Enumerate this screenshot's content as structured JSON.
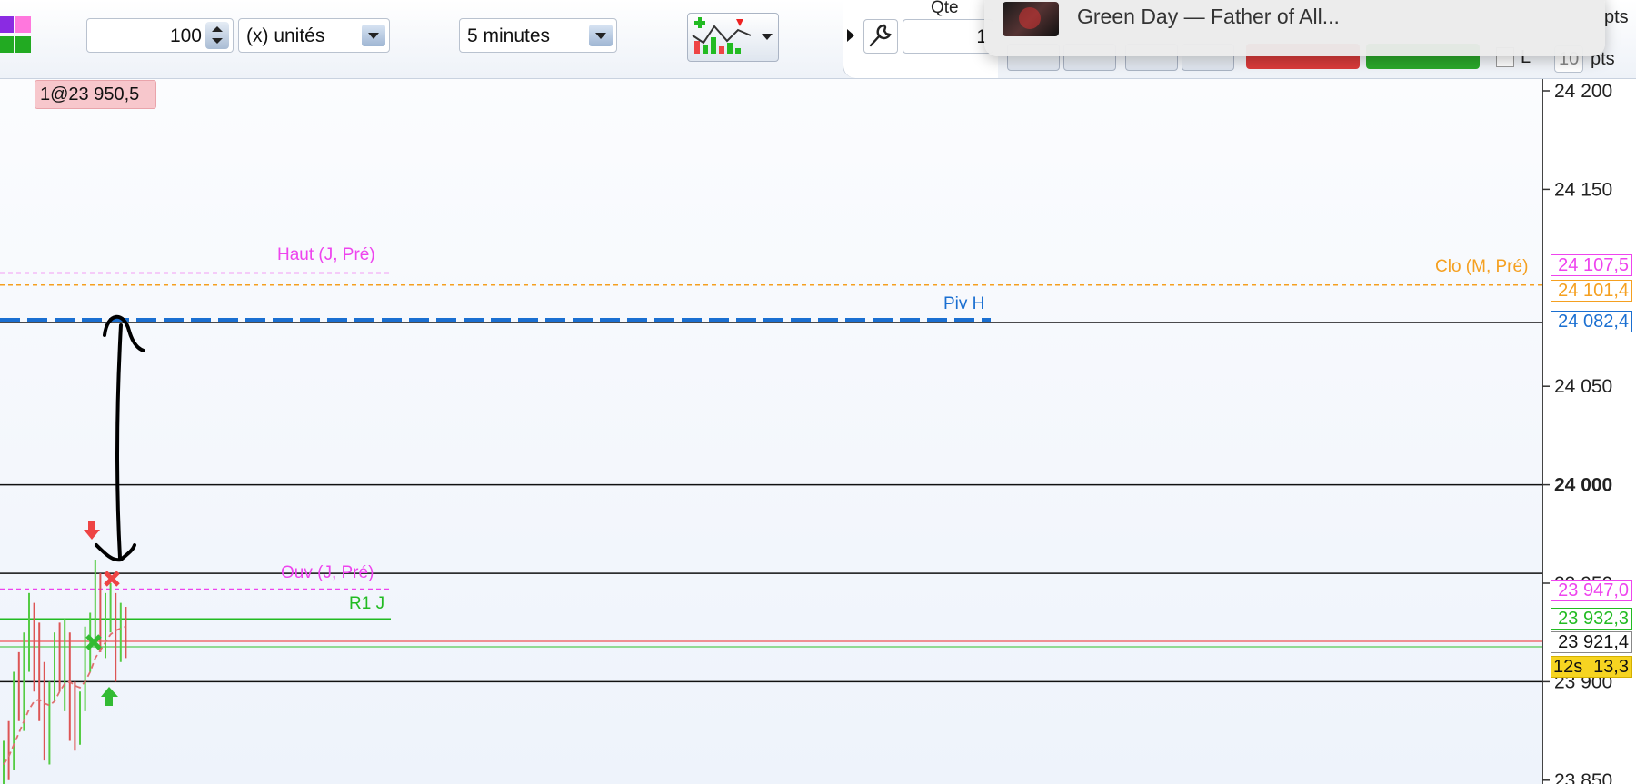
{
  "toolbar": {
    "quantity_value": "100",
    "units_label": "(x) unités",
    "interval_label": "5 minutes",
    "qte_label": "Qte",
    "qte_value": "1",
    "pts_value": "10",
    "pts_label": "pts",
    "pts_top_label": "pts",
    "l_label": "L"
  },
  "notification": {
    "text": "Green Day — Father of All..."
  },
  "order_tag": "1@23 950,5",
  "levels": {
    "haut_label": "Haut (J, Pré)",
    "haut_value": "24 107,5",
    "clo_label": "Clo (M, Pré)",
    "clo_value": "24 101,4",
    "piv_label": "Piv H",
    "piv_value": "24 082,4",
    "ouv_label": "Ouv (J, Pré)",
    "ouv_value": "23 947,0",
    "r1_label": "R1 J",
    "r1_value": "23 932,3",
    "last_value": "23 921,4",
    "timer_label": "12s",
    "timer_value": "13,3"
  },
  "colors": {
    "magenta": "#ee44ee",
    "orange": "#f5a020",
    "pivot_blue": "#1a6fd1",
    "r1_green": "#22bb22",
    "up_candle": "#55cc44",
    "down_candle": "#dd5555",
    "timer_bg": "#f6d421"
  },
  "chart_data": {
    "type": "line",
    "title": "",
    "xlabel": "",
    "ylabel": "",
    "ylim": [
      23840,
      24220
    ],
    "yticks": [
      {
        "value": 24200,
        "label": "24 200"
      },
      {
        "value": 24150,
        "label": "24 150"
      },
      {
        "value": 24050,
        "label": "24 050"
      },
      {
        "value": 24000,
        "label": "24 000"
      },
      {
        "value": 23950,
        "label": "23 950"
      },
      {
        "value": 23900,
        "label": "23 900"
      },
      {
        "value": 23850,
        "label": "23 850"
      }
    ],
    "horizontal_levels": [
      {
        "name": "Haut (J, Pré)",
        "value": 24107.5
      },
      {
        "name": "Clo (M, Pré)",
        "value": 24101.4
      },
      {
        "name": "Piv H",
        "value": 24082.4
      },
      {
        "name": "Ouv (J, Pré)",
        "value": 23947.0
      },
      {
        "name": "R1 J",
        "value": 23932.3
      },
      {
        "name": "last",
        "value": 23921.4
      }
    ],
    "price_series": [
      {
        "h": 23870,
        "l": 23842,
        "o": 23845,
        "c": 23865
      },
      {
        "h": 23880,
        "l": 23850,
        "o": 23865,
        "c": 23858
      },
      {
        "h": 23905,
        "l": 23855,
        "o": 23860,
        "c": 23900
      },
      {
        "h": 23915,
        "l": 23880,
        "o": 23900,
        "c": 23890
      },
      {
        "h": 23925,
        "l": 23875,
        "o": 23890,
        "c": 23920
      },
      {
        "h": 23945,
        "l": 23905,
        "o": 23915,
        "c": 23938
      },
      {
        "h": 23940,
        "l": 23895,
        "o": 23935,
        "c": 23900
      },
      {
        "h": 23930,
        "l": 23880,
        "o": 23900,
        "c": 23885
      },
      {
        "h": 23910,
        "l": 23860,
        "o": 23885,
        "c": 23870
      },
      {
        "h": 23900,
        "l": 23858,
        "o": 23870,
        "c": 23895
      },
      {
        "h": 23925,
        "l": 23890,
        "o": 23895,
        "c": 23920
      },
      {
        "h": 23930,
        "l": 23895,
        "o": 23918,
        "c": 23900
      },
      {
        "h": 23932,
        "l": 23885,
        "o": 23900,
        "c": 23915
      },
      {
        "h": 23925,
        "l": 23870,
        "o": 23915,
        "c": 23880
      },
      {
        "h": 23900,
        "l": 23865,
        "o": 23880,
        "c": 23872
      },
      {
        "h": 23895,
        "l": 23868,
        "o": 23872,
        "c": 23890
      },
      {
        "h": 23928,
        "l": 23885,
        "o": 23890,
        "c": 23925
      },
      {
        "h": 23935,
        "l": 23905,
        "o": 23922,
        "c": 23930
      },
      {
        "h": 23962,
        "l": 23920,
        "o": 23930,
        "c": 23958
      },
      {
        "h": 23955,
        "l": 23915,
        "o": 23955,
        "c": 23930
      },
      {
        "h": 23945,
        "l": 23912,
        "o": 23930,
        "c": 23940
      },
      {
        "h": 23950,
        "l": 23925,
        "o": 23940,
        "c": 23945
      },
      {
        "h": 23945,
        "l": 23900,
        "o": 23945,
        "c": 23915
      },
      {
        "h": 23940,
        "l": 23910,
        "o": 23915,
        "c": 23935
      },
      {
        "h": 23938,
        "l": 23912,
        "o": 23935,
        "c": 23920
      }
    ],
    "moving_average": [
      23858,
      23862,
      23868,
      23874,
      23880,
      23886,
      23890,
      23891,
      23889,
      23888,
      23890,
      23895,
      23899,
      23900,
      23898,
      23897,
      23900,
      23905,
      23912,
      23916,
      23920,
      23924,
      23926,
      23927,
      23928
    ]
  }
}
